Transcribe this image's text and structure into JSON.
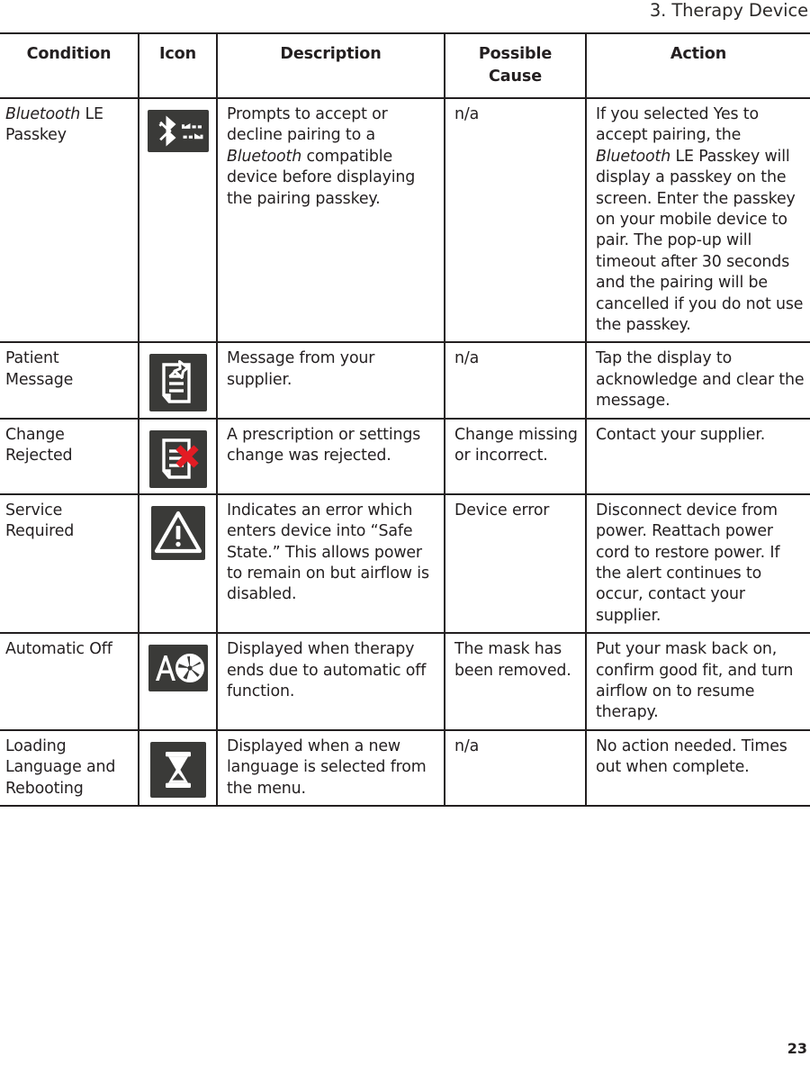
{
  "running_head": "3. Therapy Device",
  "page_number": "23",
  "table": {
    "headers": [
      "Condition",
      "Icon",
      "Description",
      "Possible Cause",
      "Action"
    ],
    "rows": [
      {
        "condition_italic": "Bluetooth",
        "condition_rest": " LE Passkey",
        "icon_name": "bluetooth-le-transfer-icon",
        "description_pre": "Prompts to accept or decline pairing to a ",
        "description_italic": "Bluetooth",
        "description_post": " compatible device before displaying the pairing passkey.",
        "possible_cause": "n/a",
        "action_pre": "If you selected Yes to accept pairing, the ",
        "action_italic": "Bluetooth",
        "action_post": " LE Passkey will display a passkey on the screen. Enter the passkey on your mobile device to pair. The pop-up will timeout after 30 seconds and the pairing will be cancelled if you do not use the passkey."
      },
      {
        "condition": "Patient Message",
        "icon_name": "pinned-document-icon",
        "description": "Message from your supplier.",
        "possible_cause": "n/a",
        "action": "Tap the display to acknowledge and clear the message."
      },
      {
        "condition": "Change Rejected",
        "icon_name": "document-rejected-icon",
        "description": "A prescription or settings change was rejected.",
        "possible_cause": "Change missing or incorrect.",
        "action": "Contact your supplier."
      },
      {
        "condition": "Service Required",
        "icon_name": "warning-triangle-icon",
        "description": "Indicates an error which enters device into “Safe State.” This allows power to remain on but airflow is disabled.",
        "possible_cause": "Device error",
        "action": "Disconnect device from power.  Reattach power cord to restore power.  If the alert continues to occur, contact your supplier."
      },
      {
        "condition": "Automatic Off",
        "icon_name": "automatic-off-blower-icon",
        "description": "Displayed when therapy ends due to automatic off function.",
        "possible_cause": "The mask has been removed.",
        "action": "Put your mask back on, confirm good fit, and turn airflow on to resume therapy."
      },
      {
        "condition": "Loading Language and Rebooting",
        "icon_name": "hourglass-icon",
        "description": "Displayed when a new language is selected from the menu.",
        "possible_cause": "n/a",
        "action": "No action needed. Times out when complete."
      }
    ]
  },
  "colors": {
    "text": "#231f20",
    "icon_tile_background": "#3a3a38",
    "icon_glyph": "#ffffff",
    "reject_mark": "#e31c24",
    "rule": "#231f20"
  }
}
